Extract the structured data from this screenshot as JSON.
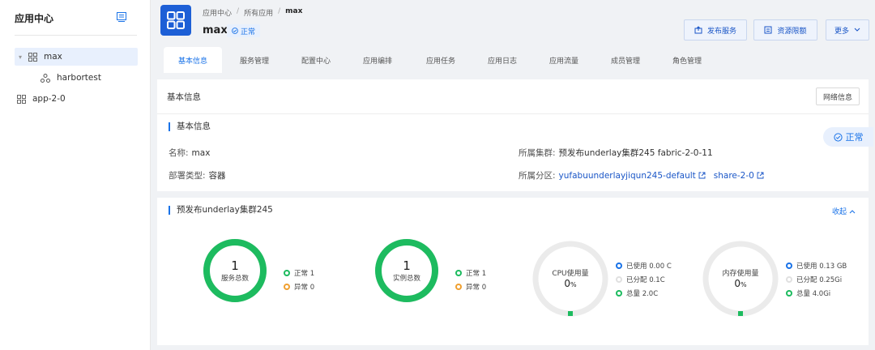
{
  "sidebar": {
    "title": "应用中心",
    "tree": [
      {
        "label": "max",
        "level": 0,
        "selected": true,
        "caret": "▾"
      },
      {
        "label": "harbortest",
        "level": 1,
        "selected": false
      },
      {
        "label": "app-2-0",
        "level": 0,
        "selected": false
      }
    ]
  },
  "header": {
    "breadcrumb": [
      "应用中心",
      "所有应用",
      "max"
    ],
    "breadcrumb_sep": "/",
    "app_name": "max",
    "status": "正常",
    "buttons": {
      "publish": "发布服务",
      "quota": "资源限额",
      "more": "更多"
    }
  },
  "tabs": [
    "基本信息",
    "服务管理",
    "配置中心",
    "应用编排",
    "应用任务",
    "应用日志",
    "应用流量",
    "成员管理",
    "角色管理"
  ],
  "basic": {
    "title": "基本信息",
    "net_button": "网络信息",
    "section": "基本信息",
    "status": "正常",
    "name_label": "名称:",
    "name_value": "max",
    "deploy_label": "部署类型:",
    "deploy_value": "容器",
    "cluster_label": "所属集群:",
    "cluster_value": "预发布underlay集群245 fabric-2-0-11",
    "partition_label": "所属分区:",
    "partition_link1": "yufabuunderlayjiqun245-default",
    "partition_link2": "share-2-0"
  },
  "cluster_panel": {
    "title": "预发布underlay集群245",
    "collapse": "收起",
    "service": {
      "count": "1",
      "caption": "服务总数",
      "normal": "正常 1",
      "abnormal": "异常 0",
      "normal_ratio": 1
    },
    "instance": {
      "count": "1",
      "caption": "实例总数",
      "normal": "正常 1",
      "abnormal": "异常 0",
      "normal_ratio": 1
    },
    "cpu": {
      "caption": "CPU使用量",
      "percent": "0",
      "unit": "%",
      "used": "已使用 0.00 C",
      "allocated": "已分配 0.1C",
      "total": "总量 2.0C"
    },
    "memory": {
      "caption": "内存使用量",
      "percent": "0",
      "unit": "%",
      "used": "已使用 0.13 GB",
      "allocated": "已分配 0.25Gi",
      "total": "总量 4.0Gi"
    }
  },
  "colors": {
    "primary": "#1a73e8",
    "green": "#1dbb5f",
    "orange": "#f0a030",
    "ring_bg": "#ebebeb",
    "logo": "#1d5fd6"
  }
}
